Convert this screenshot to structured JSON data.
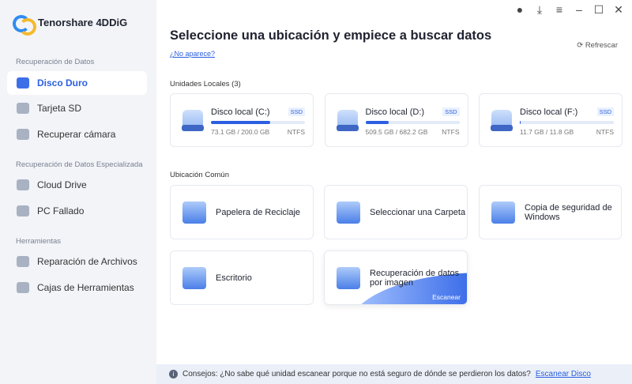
{
  "app": {
    "title": "Tenorshare 4DDiG"
  },
  "sidebar": {
    "sections": [
      {
        "title": "Recuperación de Datos",
        "items": [
          {
            "label": "Disco Duro",
            "active": true
          },
          {
            "label": "Tarjeta SD"
          },
          {
            "label": "Recuperar cámara"
          }
        ]
      },
      {
        "title": "Recuperación de Datos Especializada",
        "items": [
          {
            "label": "Cloud Drive"
          },
          {
            "label": "PC Fallado"
          }
        ]
      },
      {
        "title": "Herramientas",
        "items": [
          {
            "label": "Reparación de Archivos"
          },
          {
            "label": "Cajas de Herramientas"
          }
        ]
      }
    ]
  },
  "header": {
    "title": "Seleccione una ubicación y empiece a buscar datos",
    "no_aparece": "¿No aparece?",
    "refresh": "Refrescar"
  },
  "drives": {
    "label": "Unidades Locales (3)",
    "items": [
      {
        "name": "Disco local (C:)",
        "type": "SSD",
        "size": "73.1 GB / 200.0 GB",
        "fs": "NTFS",
        "fill": 0.63
      },
      {
        "name": "Disco local (D:)",
        "type": "SSD",
        "size": "509.5 GB / 682.2 GB",
        "fs": "NTFS",
        "fill": 0.25
      },
      {
        "name": "Disco local (F:)",
        "type": "SSD",
        "size": "11.7 GB / 11.8 GB",
        "fs": "NTFS",
        "fill": 0.01
      }
    ]
  },
  "common": {
    "label": "Ubicación Común",
    "items": [
      {
        "label": "Papelera de Reciclaje"
      },
      {
        "label": "Seleccionar una Carpeta"
      },
      {
        "label": "Copia de seguridad de Windows"
      },
      {
        "label": "Escritorio"
      },
      {
        "label": "Recuperación de datos por imagen",
        "action": "Escanear"
      }
    ]
  },
  "footer": {
    "text": "Consejos: ¿No sabe qué unidad escanear porque no está seguro de dónde se perdieron los datos?",
    "link": "Escanear Disco"
  },
  "colors": {
    "accent": "#2b5fe0"
  }
}
